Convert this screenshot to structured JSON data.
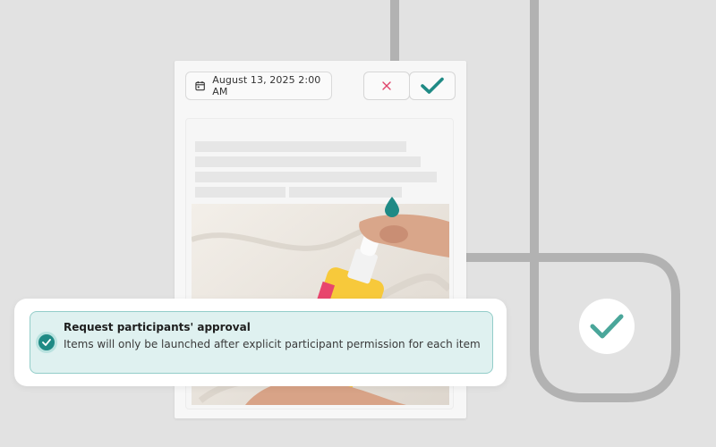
{
  "schedule": {
    "date_label": "August 13, 2025 2:00 AM",
    "calendar_icon": "calendar-icon"
  },
  "actions": {
    "reject_icon": "close-icon",
    "approve_icon": "check-icon",
    "reject_color": "#e0436a",
    "approve_color": "#1f8a85"
  },
  "approval_option": {
    "title": "Request participants' approval",
    "description": "Items will only be launched after explicit participant permission for each item",
    "checked": true,
    "accent": "#1f8a85"
  },
  "status_badge": {
    "icon": "check-icon",
    "color": "#4aa69a"
  }
}
